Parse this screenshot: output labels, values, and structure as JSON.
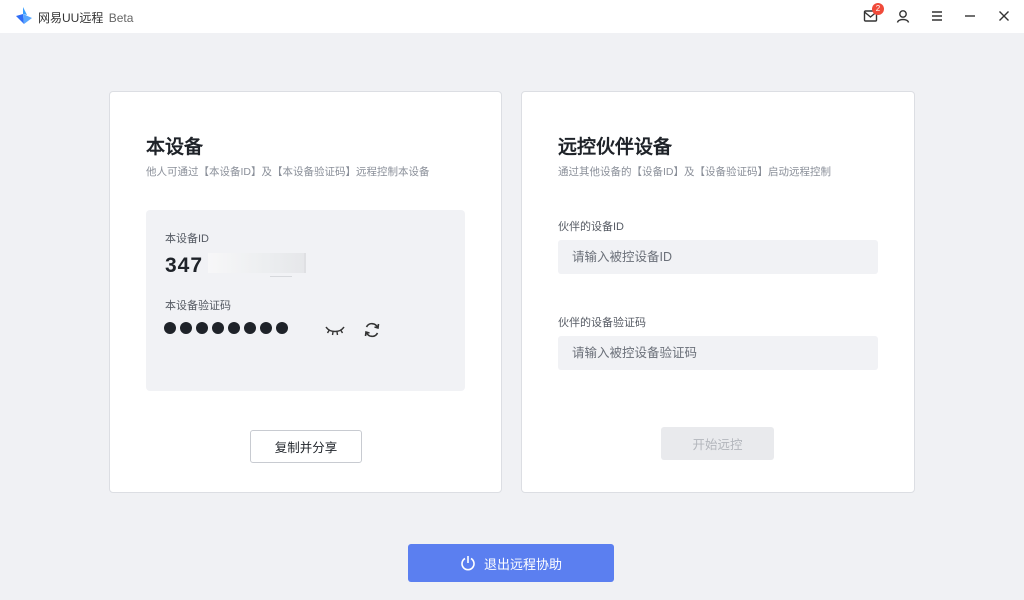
{
  "titlebar": {
    "app_name": "网易UU远程",
    "app_badge": "Beta",
    "mail_badge_count": "2",
    "icons": [
      "app-logo-icon",
      "mail-icon",
      "user-icon",
      "menu-icon",
      "minimize-icon",
      "close-icon"
    ]
  },
  "local_device": {
    "title": "本设备",
    "subtitle": "他人可通过【本设备ID】及【本设备验证码】远程控制本设备",
    "id_label": "本设备ID",
    "id_value_visible": "347",
    "code_label": "本设备验证码",
    "code_masked": "●●●●●●●●",
    "share_button": "复制并分享"
  },
  "partner_device": {
    "title": "远控伙伴设备",
    "subtitle": "通过其他设备的【设备ID】及【设备验证码】启动远程控制",
    "id_label": "伙伴的设备ID",
    "id_placeholder": "请输入被控设备ID",
    "code_label": "伙伴的设备验证码",
    "code_placeholder": "请输入被控设备验证码",
    "start_button": "开始远控"
  },
  "footer": {
    "exit_button": "退出远程协助"
  },
  "colors": {
    "accent": "#5b7ff0",
    "background": "#f0f1f4",
    "badge": "#f04a3a"
  }
}
